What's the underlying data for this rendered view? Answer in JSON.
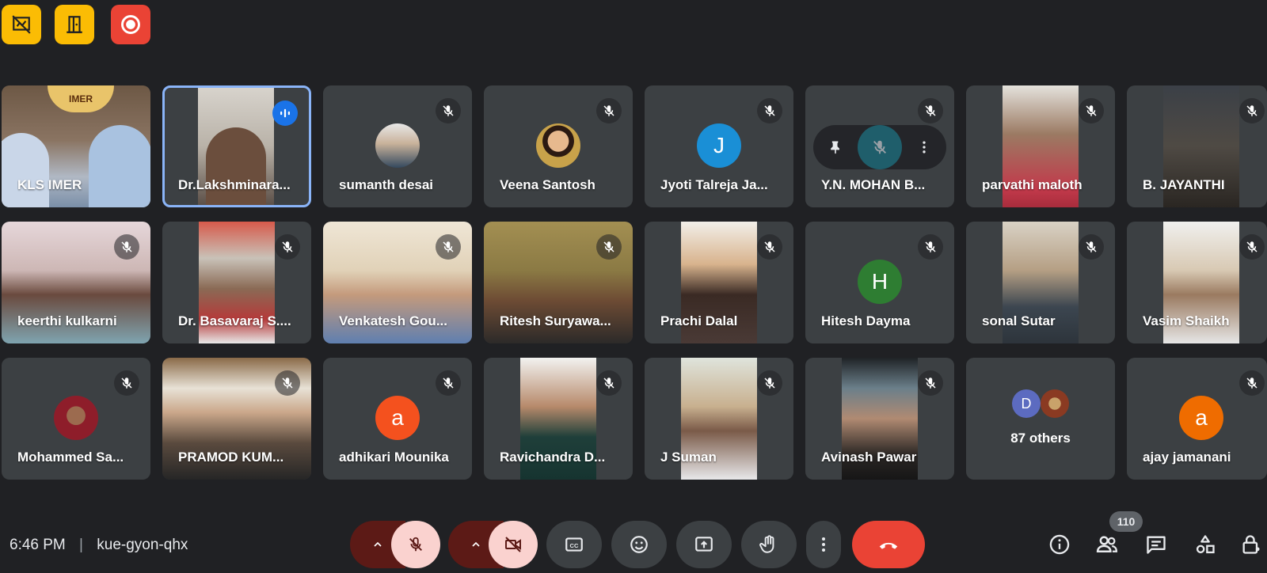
{
  "top_buttons": [
    {
      "icon": "whiteboard-off-icon",
      "color": "#fbbc04"
    },
    {
      "icon": "door-exit-icon",
      "color": "#fbbc04"
    },
    {
      "icon": "record-icon",
      "color": "#ea4335"
    }
  ],
  "tiles": {
    "kls_imer": {
      "name": "KLS IMER",
      "logo_text": "IMER"
    },
    "lakshminara": {
      "name": "Dr.Lakshminara..."
    },
    "sumanth": {
      "name": "sumanth desai"
    },
    "veena": {
      "name": "Veena Santosh"
    },
    "jyoti": {
      "name": "Jyoti Talreja Ja...",
      "initial": "J",
      "color": "#1a8fd6"
    },
    "mohan": {
      "name": "Y.N. MOHAN B..."
    },
    "parvathi": {
      "name": "parvathi maloth"
    },
    "jayanthi": {
      "name": "B. JAYANTHI"
    },
    "keerthi": {
      "name": "keerthi kulkarni"
    },
    "basavaraj": {
      "name": "Dr. Basavaraj S...."
    },
    "venkatesh": {
      "name": "Venkatesh Gou..."
    },
    "ritesh": {
      "name": "Ritesh Suryawa..."
    },
    "prachi": {
      "name": "Prachi Dalal"
    },
    "hitesh": {
      "name": "Hitesh Dayma",
      "initial": "H",
      "color": "#2e7d32"
    },
    "sonal": {
      "name": "sonal Sutar"
    },
    "vasim": {
      "name": "Vasim Shaikh"
    },
    "mohammed": {
      "name": "Mohammed Sa..."
    },
    "pramod": {
      "name": "PRAMOD KUM..."
    },
    "adhikari": {
      "name": "adhikari Mounika",
      "initial": "a",
      "color": "#f4511e"
    },
    "ravichandra": {
      "name": "Ravichandra D..."
    },
    "jsuman": {
      "name": "J Suman"
    },
    "avinash": {
      "name": "Avinash Pawar"
    },
    "others": {
      "label": "87 others",
      "initial": "D",
      "color": "#5c6bc0"
    },
    "ajay": {
      "name": "ajay jamanani",
      "initial": "a",
      "color": "#ef6c00"
    }
  },
  "bottom_bar": {
    "time": "6:46 PM",
    "separator": "|",
    "meeting_code": "kue-gyon-qhx",
    "participant_count": "110"
  },
  "colors": {
    "background": "#202124",
    "tile": "#3c4043",
    "active_border": "#8ab4f8",
    "end_call": "#ea4335",
    "muted_bg": "#fad2cf",
    "muted_dark": "#5c1a16"
  }
}
